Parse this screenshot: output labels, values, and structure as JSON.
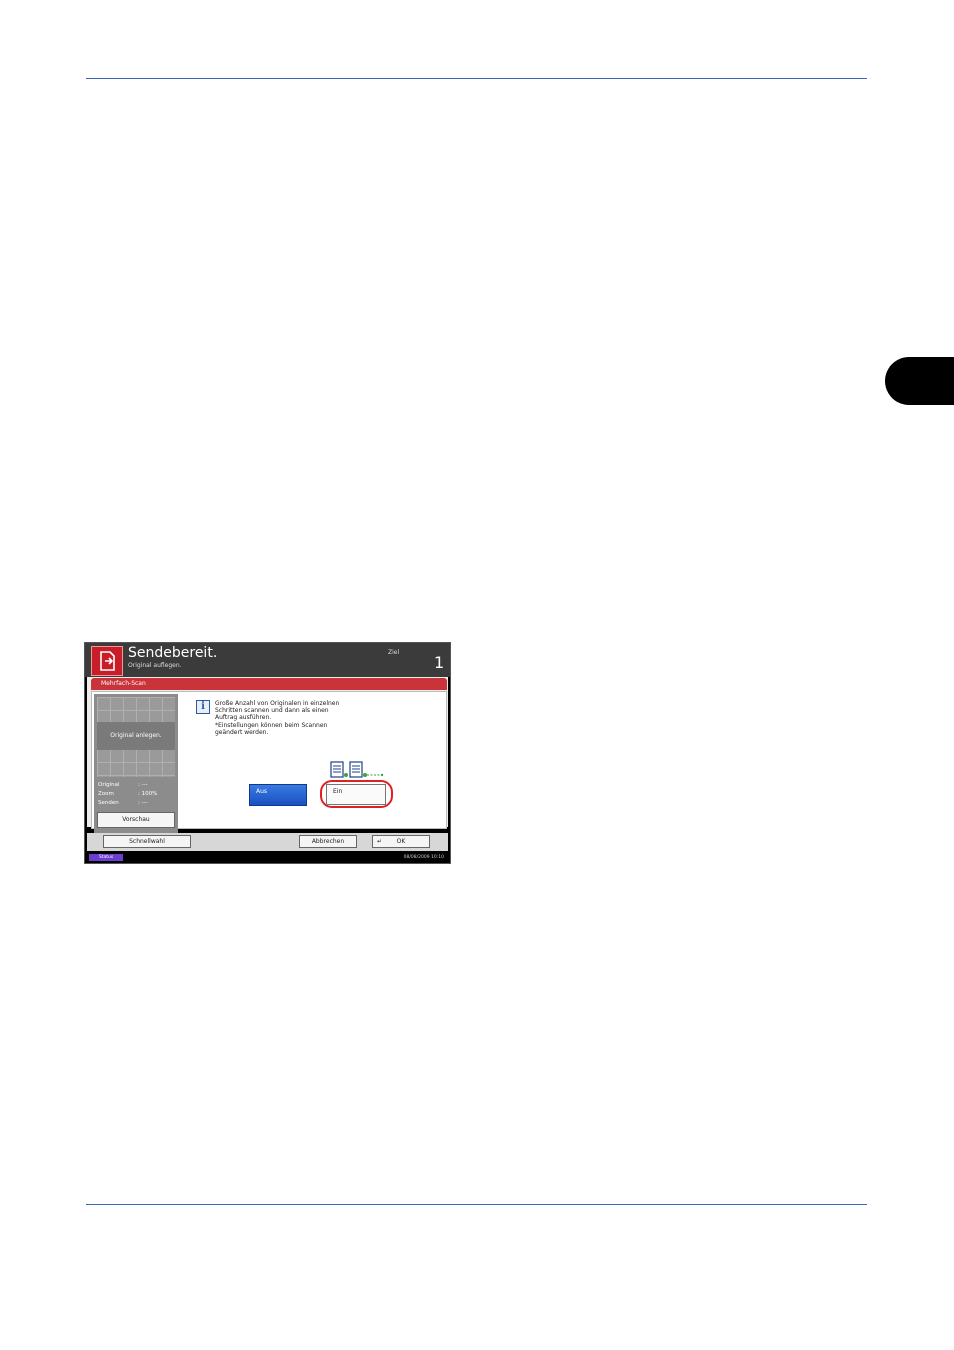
{
  "device": {
    "header": {
      "title": "Sendebereit.",
      "subtitle": "Original auflegen.",
      "ziel_label": "Ziel",
      "destination_count": "1"
    },
    "dialog": {
      "title": "Mehrfach-Scan",
      "info_lines": [
        "Große Anzahl von Originalen in einzelnen",
        "Schritten scannen und dann als einen",
        "Auftrag ausführen.",
        "*Einstellungen können beim Scannen",
        "geändert werden."
      ],
      "options": {
        "off_label": "Aus",
        "on_label": "Ein"
      }
    },
    "preview": {
      "label": "Original anlegen.",
      "rows": [
        {
          "key": "Original",
          "value": ": ---"
        },
        {
          "key": "Zoom",
          "value": ": 100%"
        },
        {
          "key": "Senden",
          "value": ": ---"
        }
      ],
      "button": "Vorschau"
    },
    "bottom": {
      "quick_dial": "Schnellwahl",
      "cancel": "Abbrechen",
      "ok": "OK"
    },
    "statusbar": {
      "status_label": "Status",
      "datetime": "08/08/2009   10:10"
    }
  },
  "colors": {
    "header_icon": "#c91d2a",
    "title_bar": "#c9333a",
    "selected_button": "#1950c0",
    "highlight_ring": "#e02020",
    "status_badge": "#6a3fd0",
    "page_rule": "#3a66b8"
  }
}
